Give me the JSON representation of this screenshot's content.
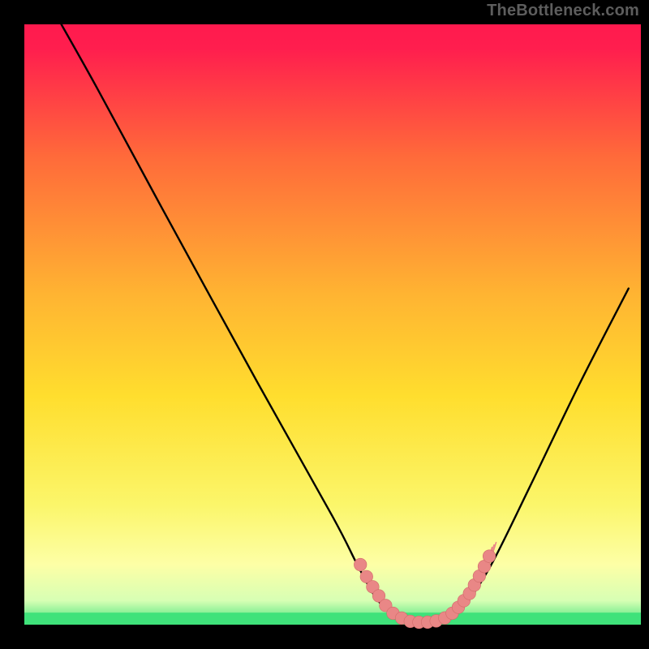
{
  "watermark": "TheBottleneck.com",
  "colors": {
    "background": "#000000",
    "curve": "#000000",
    "markers_fill": "#e98786",
    "markers_stroke": "#d06a69",
    "green_band": "#3fe27a",
    "gradient_top": "#ff1a4e",
    "gradient_mid": "#ffde2e",
    "gradient_low": "#fdffa6"
  },
  "chart_data": {
    "type": "line",
    "title": "",
    "xlabel": "",
    "ylabel": "",
    "xlim": [
      0,
      100
    ],
    "ylim": [
      0,
      100
    ],
    "grid": false,
    "legend": false,
    "annotations": [
      "TheBottleneck.com"
    ],
    "curve_points": [
      {
        "x": 6.0,
        "y": 100.0
      },
      {
        "x": 12.0,
        "y": 89.0
      },
      {
        "x": 22.0,
        "y": 70.0
      },
      {
        "x": 38.0,
        "y": 40.0
      },
      {
        "x": 50.0,
        "y": 18.0
      },
      {
        "x": 54.0,
        "y": 10.0
      },
      {
        "x": 57.0,
        "y": 4.5
      },
      {
        "x": 60.0,
        "y": 1.5
      },
      {
        "x": 63.0,
        "y": 0.5
      },
      {
        "x": 66.0,
        "y": 0.4
      },
      {
        "x": 69.0,
        "y": 1.3
      },
      {
        "x": 72.0,
        "y": 4.0
      },
      {
        "x": 76.0,
        "y": 10.5
      },
      {
        "x": 82.0,
        "y": 23.0
      },
      {
        "x": 90.0,
        "y": 40.0
      },
      {
        "x": 98.0,
        "y": 56.0
      }
    ],
    "left_markers": [
      {
        "x": 54.5,
        "y": 10.0
      },
      {
        "x": 55.5,
        "y": 8.0
      },
      {
        "x": 56.5,
        "y": 6.3
      },
      {
        "x": 57.5,
        "y": 4.8
      },
      {
        "x": 58.6,
        "y": 3.2
      },
      {
        "x": 59.8,
        "y": 1.9
      },
      {
        "x": 61.2,
        "y": 1.1
      },
      {
        "x": 62.6,
        "y": 0.55
      },
      {
        "x": 64.0,
        "y": 0.4
      },
      {
        "x": 65.4,
        "y": 0.42
      },
      {
        "x": 66.8,
        "y": 0.62
      },
      {
        "x": 68.2,
        "y": 1.12
      }
    ],
    "right_markers": [
      {
        "x": 69.4,
        "y": 1.9
      },
      {
        "x": 70.4,
        "y": 2.9
      },
      {
        "x": 71.3,
        "y": 4.0
      },
      {
        "x": 72.2,
        "y": 5.2
      },
      {
        "x": 73.0,
        "y": 6.6
      },
      {
        "x": 73.8,
        "y": 8.1
      },
      {
        "x": 74.6,
        "y": 9.7
      },
      {
        "x": 75.4,
        "y": 11.4
      }
    ],
    "green_band": {
      "y0": 0.0,
      "y1": 2.0
    },
    "min_point": {
      "x": 65.0,
      "y": 0.4
    }
  }
}
